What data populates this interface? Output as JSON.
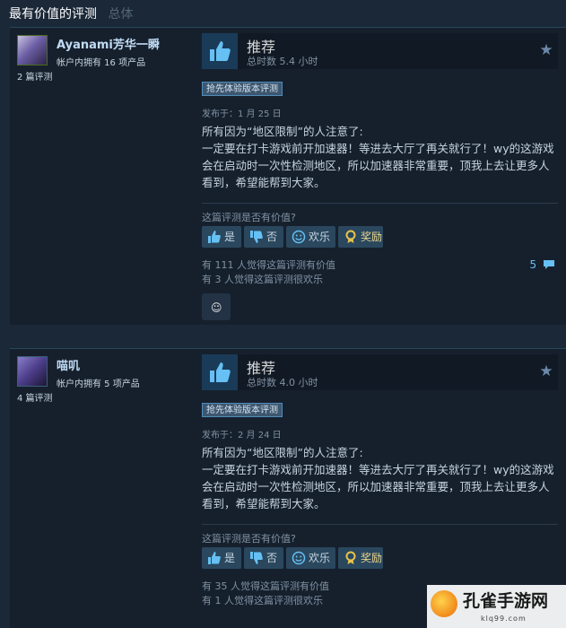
{
  "header": {
    "title": "最有价值的评测",
    "subtitle": "总体"
  },
  "reviews": [
    {
      "author": "Ayanami芳华一瞬",
      "products_owned": "帐户内拥有 16 项产品",
      "review_count": "2 篇评测",
      "verdict": "推荐",
      "hours": "总时数 5.4 小时",
      "badge": "抢先体验版本评测",
      "posted": "发布于：1 月 25 日",
      "body": "所有因为“地区限制”的人注意了:\n一定要在打卡游戏前开加速器！等进去大厅了再关就行了！wy的这游戏会在启动时一次性检测地区，所以加速器非常重要，顶我上去让更多人看到，希望能帮到大家。",
      "helpful_question": "这篇评测是否有价值?",
      "vote_yes": "是",
      "vote_no": "否",
      "vote_funny": "欢乐",
      "vote_award": "奖励",
      "helpful_stat": "有 111 人觉得这篇评测有价值",
      "funny_stat": "有 3 人觉得这篇评测很欢乐",
      "comment_count": "5"
    },
    {
      "author": "喵叽",
      "products_owned": "帐户内拥有 5 项产品",
      "review_count": "4 篇评测",
      "verdict": "推荐",
      "hours": "总时数 4.0 小时",
      "badge": "抢先体验版本评测",
      "posted": "发布于：2 月 24 日",
      "body": "所有因为“地区限制”的人注意了:\n一定要在打卡游戏前开加速器！等进去大厅了再关就行了！wy的这游戏会在启动时一次性检测地区，所以加速器非常重要，顶我上去让更多人看到，希望能帮到大家。",
      "helpful_question": "这篇评测是否有价值?",
      "vote_yes": "是",
      "vote_no": "否",
      "vote_funny": "欢乐",
      "vote_award": "奖励",
      "helpful_stat": "有 35 人觉得这篇评测有价值",
      "funny_stat": "有 1 人觉得这篇评测很欢乐"
    }
  ],
  "watermark": {
    "title": "孔雀手游网",
    "url": "klq99.com"
  },
  "icons": {
    "thumbs_up": "thumbs-up-icon",
    "star": "star-icon",
    "comment": "comment-icon",
    "award": "award-icon"
  },
  "colors": {
    "background": "#1b2838",
    "panel": "#16202d",
    "accent": "#66c0f4"
  }
}
